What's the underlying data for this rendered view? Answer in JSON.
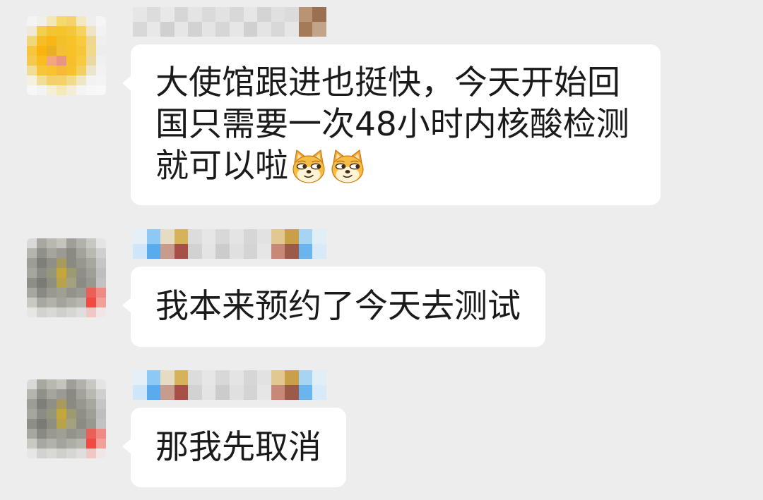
{
  "app": {
    "background": "#ededed",
    "bubble_color": "#ffffff",
    "text_color": "#1a1a1a"
  },
  "messages": [
    {
      "avatar_mosaic": [
        [
          "#f4f4f4",
          "#f0efe8",
          "#f3e8b5",
          "#f5d96a",
          "#f4d36c",
          "#f3e8c0",
          "#f0eeea",
          "#f5f5f5"
        ],
        [
          "#efe9d5",
          "#f3cf4e",
          "#f5c531",
          "#f7c32a",
          "#f4c73a",
          "#f5d35c",
          "#efe4c6",
          "#f2f2f2"
        ],
        [
          "#f0d77c",
          "#f6bd24",
          "#f8b716",
          "#f2c12a",
          "#f6c428",
          "#f7cb3c",
          "#eed790",
          "#efefef"
        ],
        [
          "#f6c63e",
          "#f9b40f",
          "#e9b024",
          "#f2c030",
          "#f6c226",
          "#f6c73b",
          "#f0d98a",
          "#ededed"
        ],
        [
          "#f4c94d",
          "#f8bd1e",
          "#f4a778",
          "#e9967e",
          "#f5c02c",
          "#f7ca40",
          "#ead9a3",
          "#f0f0f0"
        ],
        [
          "#f1dd9a",
          "#f6c53a",
          "#f8c32c",
          "#f6b93a",
          "#f5c22e",
          "#f2d060",
          "#ece5cd",
          "#f2f2f2"
        ],
        [
          "#f5f1e0",
          "#f0dd9b",
          "#f4d06c",
          "#f4d269",
          "#f2da8c",
          "#efe6c6",
          "#f2f2f2",
          "#f4f4f4"
        ],
        [
          "#f7f7f7",
          "#f3f3f3",
          "#f5efd6",
          "#f6e9b8",
          "#f3edd7",
          "#f4f4f4",
          "#f7f7f7",
          "#f8f8f8"
        ]
      ],
      "sender_name_mosaic": [
        [
          "#e6e6e6",
          "#dcdcdc",
          "#e8e8e8",
          "#d6d6d6",
          "#e4e4e4",
          "#dadada",
          "#e2e2e2",
          "#d8d8d8",
          "#e6e6e6",
          "#d4d4d4",
          "#e0e0e0",
          "#dbdbdb",
          "#b89474",
          "#9a7050"
        ],
        [
          "#d8d8d8",
          "#e8e8e8",
          "#d0d0d0",
          "#e6e6e6",
          "#d2d2d2",
          "#e4e4e4",
          "#d6d6d6",
          "#e6e6e6",
          "#d0d0d0",
          "#e4e4e4",
          "#d8d8d8",
          "#e6e6e6",
          "#a47a58",
          "#c4a488"
        ]
      ],
      "lines": [
        "大使馆跟进也挺快，今天开始回",
        "国只需要一次48小时内核酸检测",
        "就可以啦"
      ],
      "trailing_emojis": [
        "doge-emoji",
        "doge-emoji"
      ]
    },
    {
      "avatar_mosaic": [
        [
          "#d9d9d9",
          "#a9a8a0",
          "#b8b7b0",
          "#c4c3bc",
          "#9f9e98",
          "#b2b2ab",
          "#c8c8c2",
          "#e4e4e4"
        ],
        [
          "#b5b4ae",
          "#8f9088",
          "#a5a59d",
          "#9a9a92",
          "#8a8a82",
          "#a3a39a",
          "#b9b9b1",
          "#cfcfcf"
        ],
        [
          "#9d9d97",
          "#7e7f78",
          "#8f8f86",
          "#a89a5c",
          "#8a8b80",
          "#979790",
          "#a7a7a0",
          "#c5c5c5"
        ],
        [
          "#a6a69f",
          "#8c8c85",
          "#96977a",
          "#c4a63b",
          "#9c9a70",
          "#8f8f88",
          "#9f9f98",
          "#bebebe"
        ],
        [
          "#8e8e88",
          "#7a7b74",
          "#8e8f80",
          "#b8a24a",
          "#a3a180",
          "#8b8b84",
          "#98988f",
          "#c2c2c2"
        ],
        [
          "#a7a7a1",
          "#898a82",
          "#99998f",
          "#a0a092",
          "#93938b",
          "#9a9a92",
          "#e86058",
          "#f08a84"
        ],
        [
          "#c9c9c4",
          "#a8a8a1",
          "#b2b2ab",
          "#a4a49c",
          "#aeaea6",
          "#b7b7b0",
          "#f04a42",
          "#f4a09a"
        ],
        [
          "#e6e6e6",
          "#d2d2d0",
          "#d8d8d5",
          "#cfcfcb",
          "#d6d6d2",
          "#dedede",
          "#efc7c4",
          "#f2e6e5"
        ]
      ],
      "sender_name_mosaic": [
        [
          "#e4eff8",
          "#8ec8f4",
          "#e6dcc4",
          "#d6b25a",
          "#dcdcdc",
          "#e6e6e6",
          "#d8d8d8",
          "#e4e4e4",
          "#d6d6d6",
          "#e2e2e2",
          "#e0c890",
          "#c9a048",
          "#a8d4f4",
          "#e0eef8"
        ],
        [
          "#cfe6f8",
          "#5aaaf0",
          "#c89c8c",
          "#a85048",
          "#d2d2d2",
          "#e4e4e4",
          "#cccccc",
          "#e0e0e0",
          "#d4d4d4",
          "#e6e6e6",
          "#c88878",
          "#9c5a48",
          "#6ab4f0",
          "#d8eaf8"
        ]
      ],
      "lines": [
        "我本来预约了今天去测试"
      ],
      "trailing_emojis": []
    },
    {
      "avatar_mosaic": [
        [
          "#d9d9d9",
          "#a9a8a0",
          "#b8b7b0",
          "#c4c3bc",
          "#9f9e98",
          "#b2b2ab",
          "#c8c8c2",
          "#e4e4e4"
        ],
        [
          "#b5b4ae",
          "#8f9088",
          "#a5a59d",
          "#9a9a92",
          "#8a8a82",
          "#a3a39a",
          "#b9b9b1",
          "#cfcfcf"
        ],
        [
          "#9d9d97",
          "#7e7f78",
          "#8f8f86",
          "#a89a5c",
          "#8a8b80",
          "#979790",
          "#a7a7a0",
          "#c5c5c5"
        ],
        [
          "#a6a69f",
          "#8c8c85",
          "#96977a",
          "#c4a63b",
          "#9c9a70",
          "#8f8f88",
          "#9f9f98",
          "#bebebe"
        ],
        [
          "#8e8e88",
          "#7a7b74",
          "#8e8f80",
          "#b8a24a",
          "#a3a180",
          "#8b8b84",
          "#98988f",
          "#c2c2c2"
        ],
        [
          "#a7a7a1",
          "#898a82",
          "#99998f",
          "#a0a092",
          "#93938b",
          "#9a9a92",
          "#e86058",
          "#f08a84"
        ],
        [
          "#c9c9c4",
          "#a8a8a1",
          "#b2b2ab",
          "#a4a49c",
          "#aeaea6",
          "#b7b7b0",
          "#f04a42",
          "#f4a09a"
        ],
        [
          "#e6e6e6",
          "#d2d2d0",
          "#d8d8d5",
          "#cfcfcb",
          "#d6d6d2",
          "#dedede",
          "#efc7c4",
          "#f2e6e5"
        ]
      ],
      "sender_name_mosaic": [
        [
          "#e4eff8",
          "#8ec8f4",
          "#e6dcc4",
          "#d6b25a",
          "#dcdcdc",
          "#e6e6e6",
          "#d8d8d8",
          "#e4e4e4",
          "#d6d6d6",
          "#e2e2e2",
          "#e0c890",
          "#c9a048",
          "#a8d4f4",
          "#e0eef8"
        ],
        [
          "#cfe6f8",
          "#5aaaf0",
          "#c89c8c",
          "#a85048",
          "#d2d2d2",
          "#e4e4e4",
          "#cccccc",
          "#e0e0e0",
          "#d4d4d4",
          "#e6e6e6",
          "#c88878",
          "#9c5a48",
          "#6ab4f0",
          "#d8eaf8"
        ]
      ],
      "lines": [
        "那我先取消"
      ],
      "trailing_emojis": []
    }
  ]
}
